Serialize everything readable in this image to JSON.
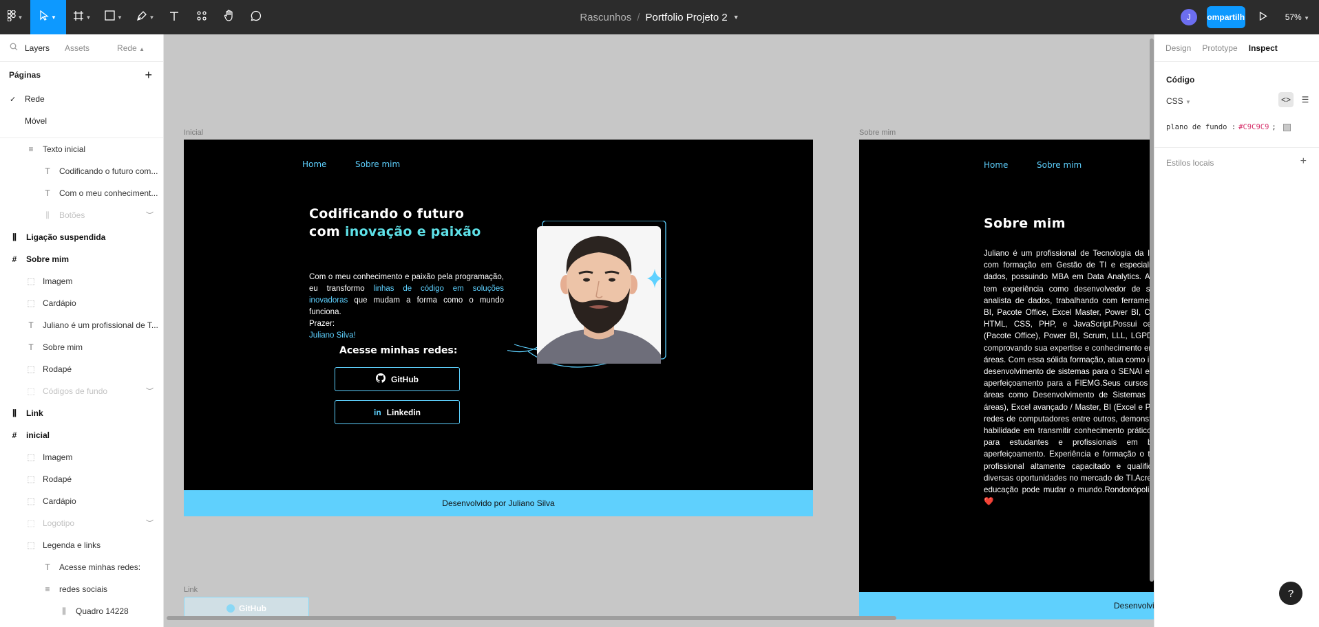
{
  "toolbar": {
    "breadcrumb_project": "Rascunhos",
    "breadcrumb_sep": "/",
    "file_title": "Portfolio Projeto 2",
    "avatar_initial": "J",
    "share_label": "ompartilh",
    "zoom": "57%"
  },
  "left_panel": {
    "tabs": [
      "Layers",
      "Assets",
      "Rede"
    ],
    "pages_label": "Páginas",
    "pages": [
      "Rede",
      "Móvel"
    ],
    "layers": [
      {
        "label": "Texto inicial",
        "icon": "text-align-icon"
      },
      {
        "label": "Codificando o futuro com...",
        "icon": "text-icon"
      },
      {
        "label": "Com o meu conheciment...",
        "icon": "text-icon"
      },
      {
        "label": "Botões",
        "icon": "auto-layout-icon"
      },
      {
        "label": "Ligação suspendida",
        "icon": "component-icon"
      },
      {
        "label": "Sobre mim",
        "icon": "frame-icon"
      },
      {
        "label": "Imagem",
        "icon": "group-icon"
      },
      {
        "label": "Cardápio",
        "icon": "group-icon"
      },
      {
        "label": "Juliano é um profissional de T...",
        "icon": "text-icon"
      },
      {
        "label": "Sobre mim",
        "icon": "text-icon"
      },
      {
        "label": "Rodapé",
        "icon": "group-icon"
      },
      {
        "label": "Códigos de fundo",
        "icon": "group-icon"
      },
      {
        "label": "Link",
        "icon": "component-icon"
      },
      {
        "label": "inicial",
        "icon": "frame-icon"
      },
      {
        "label": "Imagem",
        "icon": "group-icon"
      },
      {
        "label": "Rodapé",
        "icon": "group-icon"
      },
      {
        "label": "Cardápio",
        "icon": "group-icon"
      },
      {
        "label": "Logotipo",
        "icon": "group-icon"
      },
      {
        "label": "Legenda e links",
        "icon": "group-icon"
      },
      {
        "label": "Acesse minhas redes:",
        "icon": "text-icon"
      },
      {
        "label": "redes sociais",
        "icon": "text-align-icon"
      },
      {
        "label": "Quadro 14228",
        "icon": "auto-layout-icon"
      }
    ]
  },
  "right_panel": {
    "tabs": [
      "Design",
      "Prototype",
      "Inspect"
    ],
    "code_title": "Código",
    "language": "CSS",
    "code_prop": "plano de fundo :",
    "code_value": "#C9C9C9",
    "code_end": ";",
    "local_styles": "Estilos locais",
    "help": "?"
  },
  "canvas": {
    "frame1_label": "Inicial",
    "frame2_label": "Sobre mim",
    "frame3_label": "Link",
    "nav_home": "Home",
    "nav_sobre": "Sobre mim",
    "hero_title_1": "Codificando o futuro",
    "hero_title_2a": "com ",
    "hero_title_2b": "inovação e paixão",
    "hero_p1": "Com o meu conhecimento e paixão pela programação, eu transformo ",
    "hero_p1_link": "linhas de código em soluções inovadoras",
    "hero_p1_end": " que mudam a forma como o mundo funciona.",
    "hero_p2": "Prazer:",
    "hero_p3": "Juliano Silva!",
    "redes_title": "Acesse minhas redes:",
    "github_label": "GitHub",
    "linkedin_label": "Linkedin",
    "footer_text": "Desenvolvido por Juliano Silva",
    "about_title": "Sobre mim",
    "about_text": "Juliano é um profissional de Tecnologia da Informação com formação em Gestão de TI e especialização em dados, possuindo MBA em Data Analytics. Além disso, tem experiência como desenvolvedor de sistemas e analista de dados, trabalhando com ferramentas como BI, Pacote Office, Excel Master, Power BI, C#, Python, HTML, CSS, PHP, e JavaScript.Possui certificações (Pacote Office), Power BI, Scrum, LLL, LGPD e Inglês, comprovando sua expertise e conhecimento em diversas áreas. Com essa sólida formação, atua como instrutor de desenvolvimento de sistemas para o SENAI e cursos de aperfeiçoamento para a FIEMG.Seus cursos abrangem áreas como Desenvolvimento de Sistemas (Todas as áreas), Excel avançado / Master, BI (Excel e Power BI) e redes de computadores entre outros, demonstrando sua habilidade em transmitir conhecimento prático e valioso para estudantes e profissionais em busca de aperfeiçoamento. Experiência e formação o tornam um profissional altamente capacitado e qualificado para diversas oportunidades no mercado de TI.Acredita que a educação pode mudar o mundo.Rondonópolis coração! ❤️",
    "footer2_text": "Desenvolvido por Juliano Silva",
    "link_button": "GitHub"
  },
  "colors": {
    "accent": "#5ed1ff",
    "footer": "#5fd0fd",
    "canvas_bg": "#c9c9c9",
    "figma_blue": "#0d99ff"
  }
}
